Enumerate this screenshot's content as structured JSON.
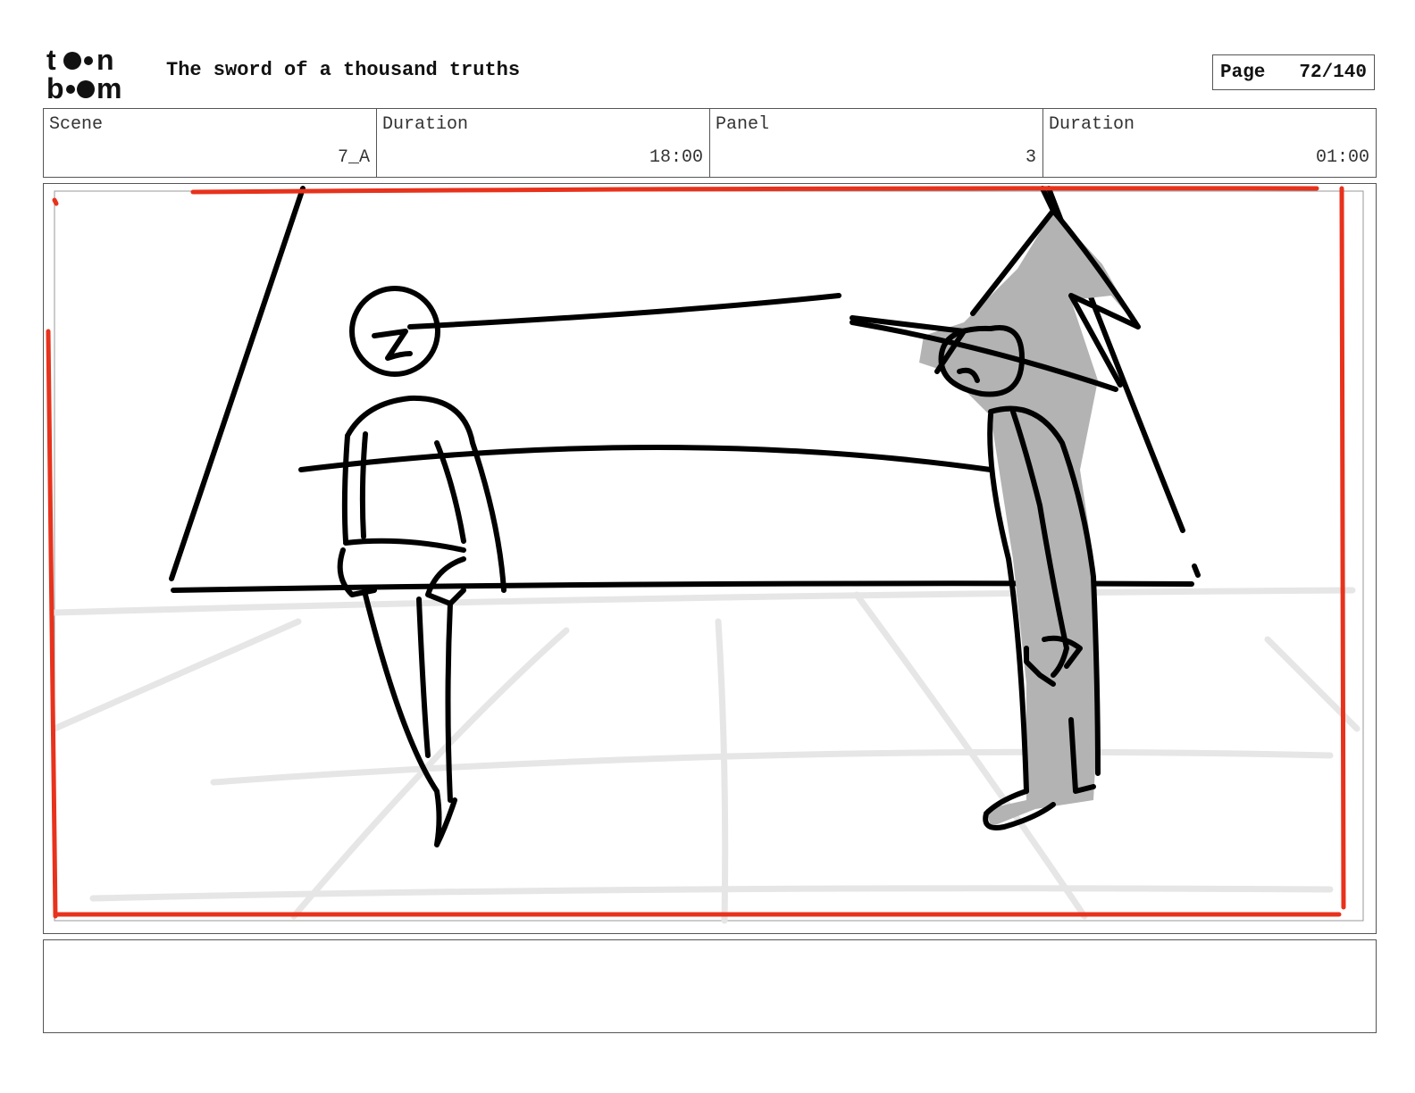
{
  "header": {
    "logo_top": "t●●n",
    "logo_bottom": "b●●m",
    "title": "The sword of a thousand truths",
    "page_label": "Page",
    "page_value": "72/140"
  },
  "info": {
    "scene_label": "Scene",
    "scene_value": "7_A",
    "scene_duration_label": "Duration",
    "scene_duration_value": "18:00",
    "panel_label": "Panel",
    "panel_value": "3",
    "panel_duration_label": "Duration",
    "panel_duration_value": "01:00"
  },
  "colors": {
    "safe_frame": "#e8321c",
    "ink": "#000000",
    "grey_fill": "#b3b3b3",
    "floor_lines": "#e6e6e6"
  },
  "notes": {
    "text": ""
  }
}
